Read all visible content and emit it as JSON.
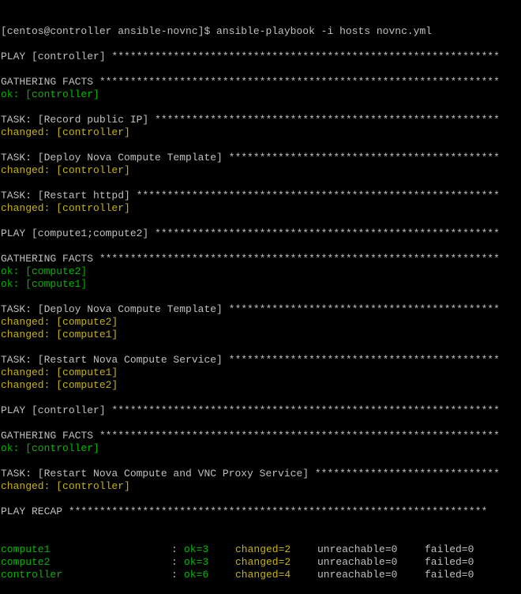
{
  "colors": {
    "background": "#000000",
    "default_text": "#c0c0c0",
    "ok": "#00b800",
    "changed": "#c8b400"
  },
  "lines": [
    {
      "text": "[centos@controller ansible-novnc]$ ansible-playbook -i hosts novnc.yml",
      "kind": "prompt"
    },
    {
      "text": "",
      "kind": "blank"
    },
    {
      "text": "PLAY [controller] ***************************************************************",
      "kind": "header"
    },
    {
      "text": "",
      "kind": "blank"
    },
    {
      "text": "GATHERING FACTS *****************************************************************",
      "kind": "header"
    },
    {
      "text": "ok: [controller]",
      "kind": "ok"
    },
    {
      "text": "",
      "kind": "blank"
    },
    {
      "text": "TASK: [Record public IP] ********************************************************",
      "kind": "header"
    },
    {
      "text": "changed: [controller]",
      "kind": "changed"
    },
    {
      "text": "",
      "kind": "blank"
    },
    {
      "text": "TASK: [Deploy Nova Compute Template] ********************************************",
      "kind": "header"
    },
    {
      "text": "changed: [controller]",
      "kind": "changed"
    },
    {
      "text": "",
      "kind": "blank"
    },
    {
      "text": "TASK: [Restart httpd] ***********************************************************",
      "kind": "header"
    },
    {
      "text": "changed: [controller]",
      "kind": "changed"
    },
    {
      "text": "",
      "kind": "blank"
    },
    {
      "text": "PLAY [compute1;compute2] ********************************************************",
      "kind": "header"
    },
    {
      "text": "",
      "kind": "blank"
    },
    {
      "text": "GATHERING FACTS *****************************************************************",
      "kind": "header"
    },
    {
      "text": "ok: [compute2]",
      "kind": "ok"
    },
    {
      "text": "ok: [compute1]",
      "kind": "ok"
    },
    {
      "text": "",
      "kind": "blank"
    },
    {
      "text": "TASK: [Deploy Nova Compute Template] ********************************************",
      "kind": "header"
    },
    {
      "text": "changed: [compute2]",
      "kind": "changed"
    },
    {
      "text": "changed: [compute1]",
      "kind": "changed"
    },
    {
      "text": "",
      "kind": "blank"
    },
    {
      "text": "TASK: [Restart Nova Compute Service] ********************************************",
      "kind": "header"
    },
    {
      "text": "changed: [compute1]",
      "kind": "changed"
    },
    {
      "text": "changed: [compute2]",
      "kind": "changed"
    },
    {
      "text": "",
      "kind": "blank"
    },
    {
      "text": "PLAY [controller] ***************************************************************",
      "kind": "header"
    },
    {
      "text": "",
      "kind": "blank"
    },
    {
      "text": "GATHERING FACTS *****************************************************************",
      "kind": "header"
    },
    {
      "text": "ok: [controller]",
      "kind": "ok"
    },
    {
      "text": "",
      "kind": "blank"
    },
    {
      "text": "TASK: [Restart Nova Compute and VNC Proxy Service] ******************************",
      "kind": "header"
    },
    {
      "text": "changed: [controller]",
      "kind": "changed"
    },
    {
      "text": "",
      "kind": "blank"
    },
    {
      "text": "PLAY RECAP ********************************************************************",
      "kind": "header"
    }
  ],
  "recap": [
    {
      "host": "compute1",
      "sep": ":",
      "ok": "ok=3",
      "changed": "changed=2",
      "unreachable": "unreachable=0",
      "failed": "failed=0"
    },
    {
      "host": "compute2",
      "sep": ":",
      "ok": "ok=3",
      "changed": "changed=2",
      "unreachable": "unreachable=0",
      "failed": "failed=0"
    },
    {
      "host": "controller",
      "sep": ":",
      "ok": "ok=6",
      "changed": "changed=4",
      "unreachable": "unreachable=0",
      "failed": "failed=0"
    }
  ]
}
